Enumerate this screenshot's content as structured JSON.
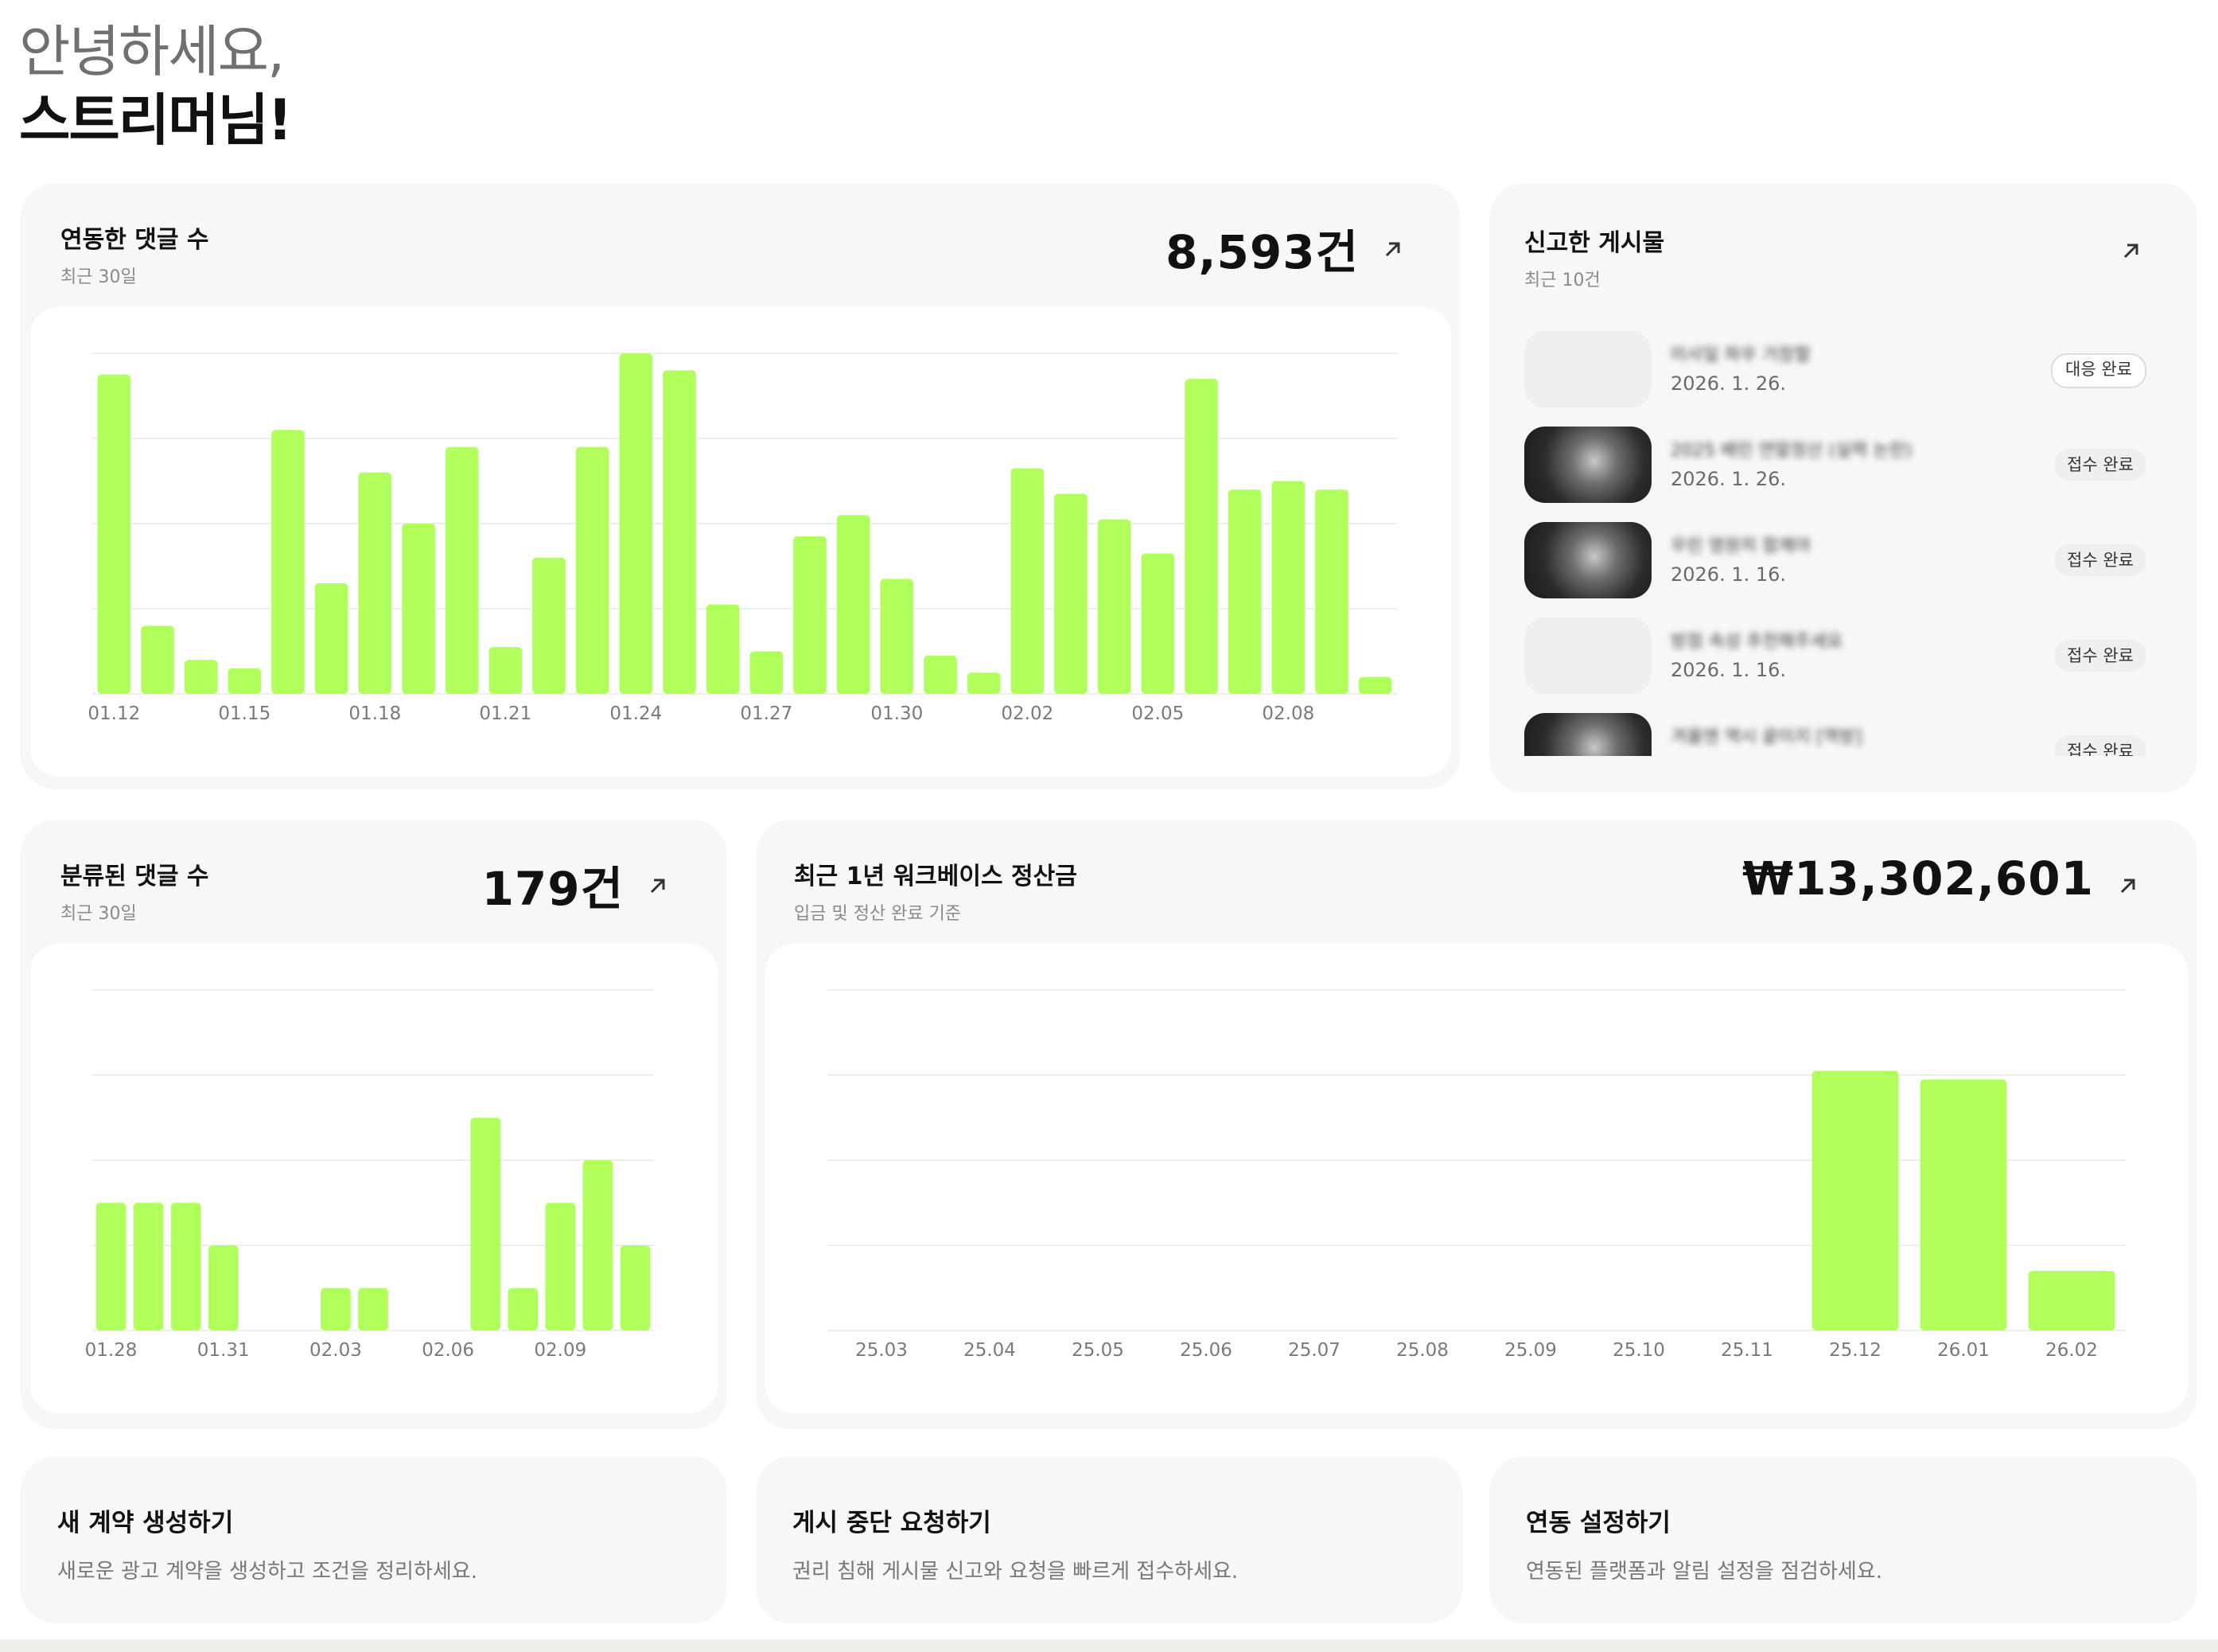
{
  "greeting": {
    "line1": "안녕하세요,",
    "line2": "스트리머님!"
  },
  "colors": {
    "accent": "#b0ff5b",
    "card_bg": "#f7f7f7",
    "grid": "#eeeeee"
  },
  "comments_card": {
    "title": "연동한 댓글 수",
    "subtitle": "최근 30일",
    "total": "8,593건",
    "link_icon": "arrow-up-right-icon",
    "chart_data": {
      "type": "bar",
      "ylim": [
        0,
        8
      ],
      "grid": true,
      "tick_labels": [
        "01.12",
        "01.15",
        "01.18",
        "01.21",
        "01.24",
        "01.27",
        "01.30",
        "02.02",
        "02.05",
        "02.08"
      ],
      "values": [
        7.5,
        1.6,
        0.8,
        0.6,
        6.2,
        2.6,
        5.2,
        4.0,
        5.8,
        1.1,
        3.2,
        5.8,
        8.0,
        7.6,
        2.1,
        1.0,
        3.7,
        4.2,
        2.7,
        0.9,
        0.5,
        5.3,
        4.7,
        4.1,
        3.3,
        7.4,
        4.8,
        5.0,
        4.8,
        0.4
      ]
    }
  },
  "reports_card": {
    "title": "신고한 게시물",
    "subtitle": "최근 10건",
    "link_icon": "arrow-up-right-icon",
    "items": [
      {
        "title": "미사일 파우 거창할",
        "date": "2026. 1. 26.",
        "status": "대응 완료",
        "thumb": "light"
      },
      {
        "title": "2025 배민 연말정산 (실력 논란)",
        "date": "2026. 1. 26.",
        "status": "접수 완료",
        "thumb": "dark"
      },
      {
        "title": "우린 영원히 함께야",
        "date": "2026. 1. 16.",
        "status": "접수 완료",
        "thumb": "dark"
      },
      {
        "title": "방점 속성 추천해주세요",
        "date": "2026. 1. 16.",
        "status": "접수 완료",
        "thumb": "light"
      },
      {
        "title": "겨울엔 역시 끝이지 [역방]",
        "date": "",
        "status": "접수 완료",
        "thumb": "dark"
      }
    ]
  },
  "classified_card": {
    "title": "분류된 댓글 수",
    "subtitle": "최근 30일",
    "total": "179건",
    "link_icon": "arrow-up-right-icon",
    "chart_data": {
      "type": "bar",
      "ylim": [
        0,
        8
      ],
      "grid": true,
      "tick_labels": [
        "01.28",
        "01.31",
        "02.03",
        "02.06",
        "02.09"
      ],
      "values": [
        3,
        3,
        3,
        2,
        0,
        0,
        1,
        1,
        0,
        0,
        5,
        1,
        3,
        4,
        2
      ]
    }
  },
  "settlement_card": {
    "title": "최근 1년 워크베이스 정산금",
    "subtitle": "입금 및 정산 완료 기준",
    "total": "₩13,302,601",
    "link_icon": "arrow-up-right-icon",
    "chart_data": {
      "type": "bar",
      "ylim": [
        0,
        8
      ],
      "grid": true,
      "categories": [
        "25.03",
        "25.04",
        "25.05",
        "25.06",
        "25.07",
        "25.08",
        "25.09",
        "25.10",
        "25.11",
        "25.12",
        "26.01",
        "26.02"
      ],
      "values": [
        0,
        0,
        0,
        0,
        0,
        0,
        0,
        0,
        0,
        6.1,
        5.9,
        1.4
      ]
    }
  },
  "actions": [
    {
      "title": "새 계약 생성하기",
      "desc": "새로운 광고 계약을 생성하고 조건을 정리하세요."
    },
    {
      "title": "게시 중단 요청하기",
      "desc": "권리 침해 게시물 신고와 요청을 빠르게 접수하세요."
    },
    {
      "title": "연동 설정하기",
      "desc": "연동된 플랫폼과 알림 설정을 점검하세요."
    }
  ]
}
